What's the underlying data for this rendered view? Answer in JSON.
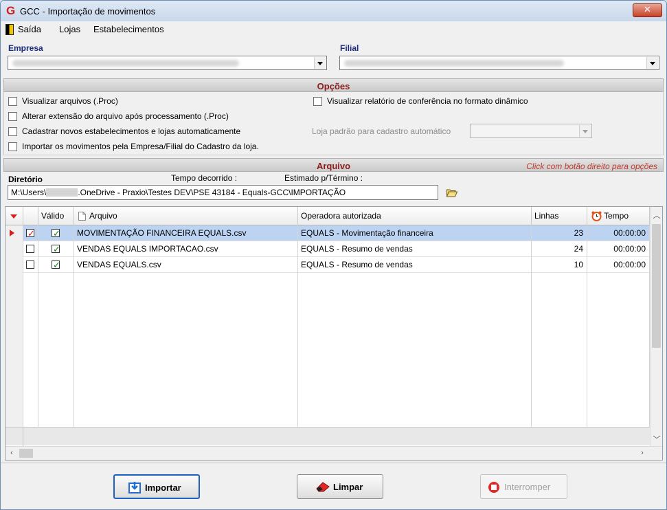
{
  "window": {
    "title": "GCC - Importação de movimentos",
    "close_glyph": "✕"
  },
  "menu": {
    "items": [
      "Saída",
      "Lojas",
      "Estabelecimentos"
    ]
  },
  "empresa": {
    "label": "Empresa",
    "value": ""
  },
  "filial": {
    "label": "Filial",
    "value": ""
  },
  "opcoes": {
    "title": "Opções",
    "checkboxes": [
      {
        "label": "Visualizar arquivos (.Proc)",
        "checked": false
      },
      {
        "label": "Alterar extensão do arquivo após processamento (.Proc)",
        "checked": false
      },
      {
        "label": "Cadastrar novos estabelecimentos e lojas automaticamente",
        "checked": false
      },
      {
        "label": "Importar os movimentos pela Empresa/Filial do Cadastro da loja.",
        "checked": false
      },
      {
        "label": "Visualizar relatório de conferência no formato dinâmico",
        "checked": false
      }
    ],
    "loja_padrao_label": "Loja padrão para cadastro automático",
    "loja_padrao_value": ""
  },
  "arquivo": {
    "title": "Arquivo",
    "hint": "Click com botão direito para opções",
    "diretorio_label": "Diretório",
    "tempo_decorrido_label": "Tempo decorrido :",
    "estimado_label": "Estimado p/Término :",
    "path_prefix": "M:\\Users\\",
    "path_suffix": ".OneDrive - Praxio\\Testes DEV\\PSE 43184 - Equals-GCC\\IMPORTAÇÃO"
  },
  "grid": {
    "columns": [
      "",
      "",
      "Válido",
      "Arquivo",
      "Operadora autorizada",
      "Linhas",
      "Tempo"
    ],
    "rows": [
      {
        "selected": true,
        "checked": true,
        "valid": true,
        "arquivo": "MOVIMENTAÇÃO FINANCEIRA EQUALS.csv",
        "operadora": "EQUALS - Movimentação financeira",
        "linhas": "23",
        "tempo": "00:00:00"
      },
      {
        "selected": false,
        "checked": false,
        "valid": true,
        "arquivo": "VENDAS EQUALS IMPORTACAO.csv",
        "operadora": "EQUALS - Resumo de vendas",
        "linhas": "24",
        "tempo": "00:00:00"
      },
      {
        "selected": false,
        "checked": false,
        "valid": true,
        "arquivo": "VENDAS EQUALS.csv",
        "operadora": "EQUALS - Resumo de vendas",
        "linhas": "10",
        "tempo": "00:00:00"
      }
    ]
  },
  "buttons": {
    "importar": "Importar",
    "limpar": "Limpar",
    "interromper": "Interromper"
  },
  "colors": {
    "accent_red": "#d42020",
    "header_blue": "#1a2a7a",
    "selection": "#bcd4f1"
  }
}
